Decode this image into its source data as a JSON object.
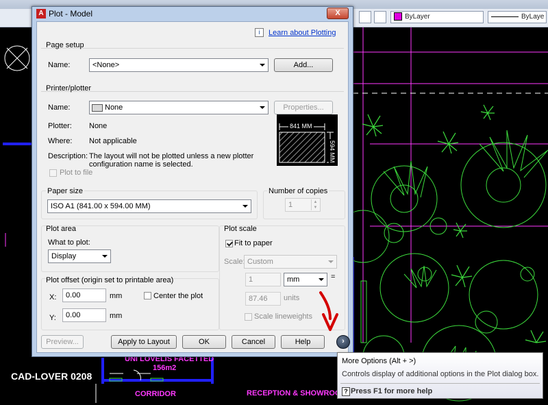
{
  "dialog": {
    "title": "Plot - Model",
    "close_label": "X",
    "learn_link": "Learn about Plotting",
    "info_icon": "i",
    "page_setup": {
      "title": "Page setup",
      "name_label": "Name:",
      "name_value": "<None>",
      "add_label": "Add..."
    },
    "printer": {
      "title": "Printer/plotter",
      "name_label": "Name:",
      "name_value": "None",
      "properties_label": "Properties...",
      "plotter_label": "Plotter:",
      "plotter_value": "None",
      "where_label": "Where:",
      "where_value": "Not applicable",
      "description_label": "Description:",
      "description_line1": "The layout will not be plotted unless a new plotter",
      "description_line2": "configuration name is selected.",
      "plot_to_file_label": "Plot to file",
      "preview_width": "841 MM",
      "preview_height": "594 MM"
    },
    "paper_size": {
      "title": "Paper size",
      "value": "ISO A1 (841.00 x 594.00 MM)"
    },
    "copies": {
      "title": "Number of copies",
      "value": "1"
    },
    "plot_area": {
      "title": "Plot area",
      "what_label": "What to plot:",
      "what_value": "Display"
    },
    "plot_offset": {
      "title": "Plot offset (origin set to printable area)",
      "x_label": "X:",
      "x_value": "0.00",
      "x_unit": "mm",
      "y_label": "Y:",
      "y_value": "0.00",
      "y_unit": "mm",
      "center_label": "Center the plot"
    },
    "plot_scale": {
      "title": "Plot scale",
      "fit_label": "Fit to paper",
      "scale_label": "Scale:",
      "scale_value": "Custom",
      "value1": "1",
      "unit1": "mm",
      "equals": "=",
      "value2": "87.46",
      "unit2": "units",
      "lineweights_label": "Scale lineweights"
    },
    "buttons": {
      "preview": "Preview...",
      "apply": "Apply to Layout",
      "ok": "OK",
      "cancel": "Cancel",
      "help": "Help"
    }
  },
  "toolbar": {
    "layer_value": "ByLayer",
    "linetype_value": "ByLaye"
  },
  "tooltip": {
    "title": "More Options (Alt + >)",
    "description": "Controls display of additional options in the Plot dialog box.",
    "help": "Press F1 for more help"
  },
  "drawing": {
    "label1": "156m2",
    "label2": "CORRIDOR",
    "label3": "RECEPTION & SHOWROOM",
    "label4": "UNI LOVELIS FACETTED",
    "watermark": "CAD-LOVER 0208"
  },
  "colors": {
    "accent_link": "#0033cc",
    "cad_magenta": "#ff39ff",
    "cad_green": "#3ddc3d",
    "cad_blue": "#2020ff",
    "annotation_red": "#d40000"
  }
}
